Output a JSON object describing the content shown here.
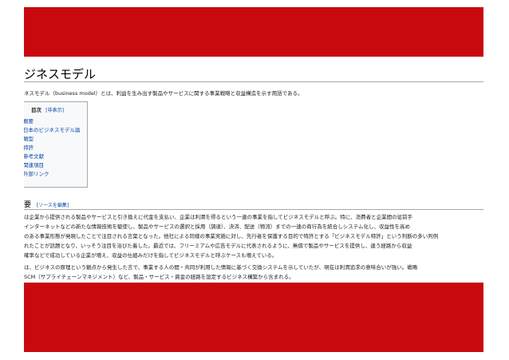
{
  "article": {
    "title": "ジネスモデル",
    "lead": "ネスモデル（business model）とは、利益を生み出す製品やサービスに関する事業戦略と収益構造を示す用語である。"
  },
  "toc": {
    "heading": "目次",
    "toggle": "[非表示]",
    "items": [
      "概要",
      "日本のビジネスモデル論",
      "類型",
      "特許",
      "参考文献",
      "関連項目",
      "外部リンク"
    ]
  },
  "section": {
    "heading": "要",
    "edit": "[ソースを編集]",
    "paragraph1": [
      "は企業から提供される製品やサービスと引き換えに代金を支払い、企業は利潤を得るという一連の事業を指してビジネスモデルと呼ぶ。特に、消費者と企業間の従前手",
      "インターネットなどの新たな情報技術を駆使し、製品やサービスの選択と採用（調達）、決済、配送（物流）までの一連の商行為を統合しシステム化し、収益性を高め",
      "のある事業形態が発現したことで注目される言葉となった。他社による同様の事業実施に対し、先行者を保護する目的で特許とする「ビジネスモデル特許」という判断の多い判例",
      "れたことが話題となり、いっそう注目を浴びた着した。最近では、フリーミアムや広告モデルに代表されるように、無償で製品やサービスを提供し、違う経路から収益",
      "確率などで成功している企業が増え、収益の仕組みだけを指してビジネスモデルと呼ぶケースも増えている。"
    ],
    "paragraph2": [
      "は、ビジネスの原理という観点から発生した言で、事業する人の間・共同が利用した情報に基づく交換システムを示していたが、現在は利潤追求の意味合いが強い。戦略",
      "SCM（サプライチェーンマネジメント）など、製品・サービス・資金の経路を設定するビジネス構築から含まれる。"
    ]
  },
  "colors": {
    "banner": "#c80a0e",
    "link": "#0645ad",
    "text": "#202122"
  }
}
